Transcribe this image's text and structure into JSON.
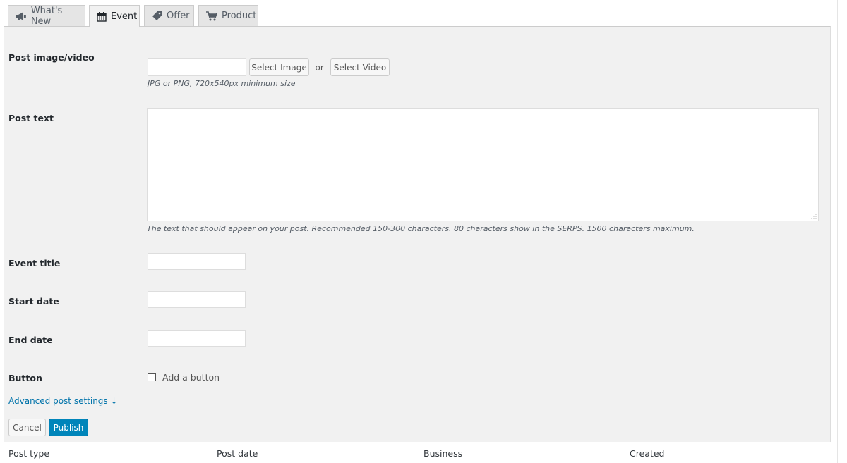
{
  "tabs": [
    {
      "label": "What's New",
      "icon": "megaphone-icon"
    },
    {
      "label": "Event",
      "icon": "calendar-icon"
    },
    {
      "label": "Offer",
      "icon": "tag-icon"
    },
    {
      "label": "Product",
      "icon": "cart-icon"
    }
  ],
  "active_tab": "Event",
  "form": {
    "post_image": {
      "label": "Post image/video",
      "value": "",
      "select_image": "Select Image",
      "or": "-or-",
      "select_video": "Select Video",
      "hint": "JPG or PNG, 720x540px minimum size"
    },
    "post_text": {
      "label": "Post text",
      "value": "",
      "hint": "The text that should appear on your post. Recommended 150-300 characters. 80 characters show in the SERPS. 1500 characters maximum."
    },
    "event_title": {
      "label": "Event title",
      "value": ""
    },
    "start_date": {
      "label": "Start date",
      "value": ""
    },
    "end_date": {
      "label": "End date",
      "value": ""
    },
    "button": {
      "label": "Button",
      "checkbox_label": "Add a button",
      "checked": false
    },
    "advanced_link": "Advanced post settings ↓",
    "cancel": "Cancel",
    "publish": "Publish"
  },
  "table": {
    "columns": [
      "Post type",
      "Post date",
      "Business",
      "Created"
    ]
  },
  "colors": {
    "accent": "#0085ba",
    "link": "#0073aa",
    "panel_bg": "#f1f1f1"
  }
}
